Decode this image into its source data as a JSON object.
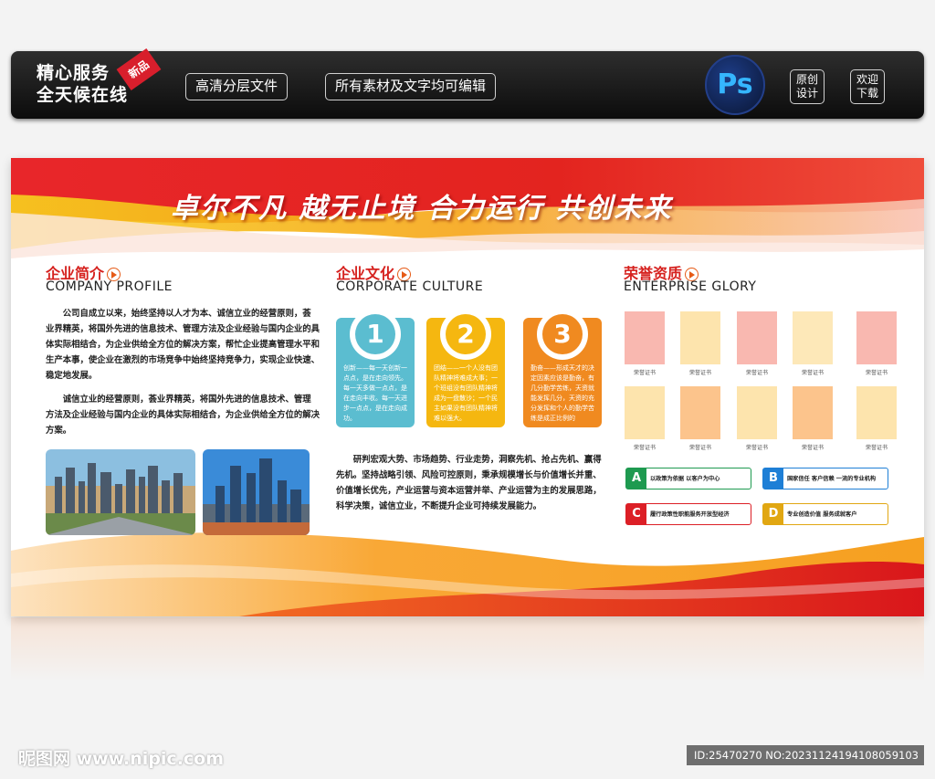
{
  "topbar": {
    "slogan_line1": "精心服务",
    "slogan_line2": "全天候在线",
    "ribbon": "新品",
    "pill1": "高清分层文件",
    "pill2": "所有素材及文字均可编辑",
    "ps_label": "Ps",
    "btn_original": "原创\n设计",
    "btn_download": "欢迎\n下载"
  },
  "board": {
    "headline": "卓尔不凡  越无止境  合力运行  共创未来",
    "profile": {
      "title": "企业简介",
      "en": "COMPANY PROFILE",
      "p1": "公司自成立以来，始终坚持以人才为本、诚信立业的经营原则，荟业界精英，将国外先进的信息技术、管理方法及企业经验与国内企业的具体实际相结合，为企业供给全方位的解决方案，帮忙企业提高管理水平和生产本事，使企业在激烈的市场竞争中始终坚持竞争力，实现企业快速、稳定地发展。",
      "p2": "诚信立业的经营原则，荟业界精英，将国外先进的信息技术、管理方法及企业经验与国内企业的具体实际相结合，为企业供给全方位的解决方案。"
    },
    "culture": {
      "title": "企业文化",
      "en": "CORPORATE CULTURE",
      "cards": [
        {
          "num": "1",
          "color": "#5bbdd0",
          "text": "创新——每一天创新一点点，是在走向领先。每一天多做一点点，是在走向丰收。每一天进步一点点，是在走向成功。"
        },
        {
          "num": "2",
          "color": "#f5b710",
          "text": "团结——一个人没有团队精神将难成大事；一个班组没有团队精神将成为一盘散沙；一个民主如果没有团队精神将难以强大。"
        },
        {
          "num": "3",
          "color": "#f08a20",
          "text": "勤奋——形成天才的决定因素应该是勤奋，有几分勤学苦练，天资就能发挥几分，天资的充分发挥和个人的勤学苦练是成正比例的"
        }
      ],
      "para": "研判宏观大势、市场趋势、行业走势，洞察先机、抢占先机、赢得先机。坚持战略引领、风险可控原则，秉承规模增长与价值增长并重、价值增长优先，产业运营与资本运营并举、产业运营为主的发展思路，科学决策，诚信立业，不断提升企业可持续发展能力。"
    },
    "glory": {
      "title": "荣誉资质",
      "en": "ENTERPRISE GLORY",
      "cert_label": "荣誉证书",
      "cert_colors": [
        "#f9b8b0",
        "#fde4ad",
        "#f9b8b0",
        "#fde8b8",
        "#f9b8b0",
        "#fde4ad",
        "#fcc48c",
        "#fde4ad",
        "#fcc48c",
        "#fde4ad"
      ],
      "boxes": [
        {
          "letter": "A",
          "color": "#1e9a50",
          "text": "以政策为依据 以客户为中心"
        },
        {
          "letter": "B",
          "color": "#1e7fd6",
          "text": "国家信任 客户信赖 一流的专业机构"
        },
        {
          "letter": "C",
          "color": "#dc1f26",
          "text": "履行政策性职能服务开放型经济"
        },
        {
          "letter": "D",
          "color": "#e1a712",
          "text": "专业创造价值 服务成就客户"
        }
      ]
    }
  },
  "footer": {
    "watermark": "昵图网 www.nipic.com",
    "id_text": "ID:25470270 NO:20231124194108059103"
  }
}
